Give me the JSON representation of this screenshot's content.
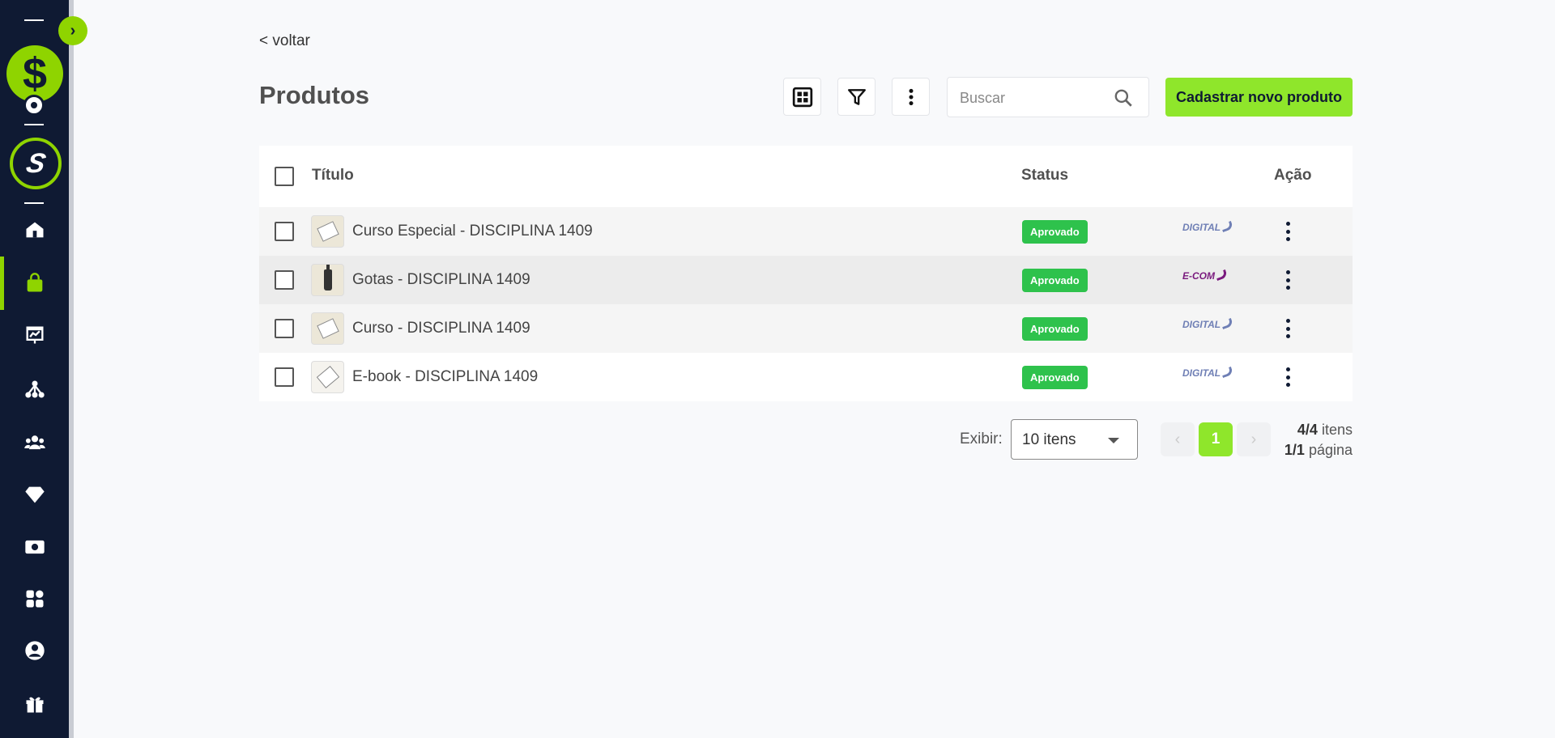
{
  "nav": {
    "back_label": "< voltar"
  },
  "page": {
    "title": "Produtos"
  },
  "search": {
    "placeholder": "Buscar"
  },
  "actions": {
    "new_product_label": "Cadastrar novo produto"
  },
  "sidebar": {
    "logo_symbol": "$",
    "brand_symbol": "S",
    "toggle_symbol": "›",
    "items": [
      {
        "name": "home",
        "icon": "home-icon",
        "active": false
      },
      {
        "name": "products",
        "icon": "shopping-bag-icon",
        "active": true
      },
      {
        "name": "reports",
        "icon": "presentation-chart-icon",
        "active": false
      },
      {
        "name": "affiliates",
        "icon": "network-icon",
        "active": false
      },
      {
        "name": "customers",
        "icon": "users-icon",
        "active": false
      },
      {
        "name": "premium",
        "icon": "diamond-icon",
        "active": false
      },
      {
        "name": "finance",
        "icon": "money-icon",
        "active": false
      },
      {
        "name": "apps",
        "icon": "apps-grid-icon",
        "active": false
      },
      {
        "name": "profile",
        "icon": "user-circle-icon",
        "active": false
      },
      {
        "name": "rewards",
        "icon": "gift-icon",
        "active": false
      }
    ]
  },
  "table": {
    "columns": {
      "title": "Título",
      "status": "Status",
      "action": "Ação"
    },
    "rows": [
      {
        "title": "Curso Especial - DISCIPLINA 1409",
        "status": "Aprovado",
        "type": "DIGITAL",
        "thumb": "paper"
      },
      {
        "title": "Gotas - DISCIPLINA 1409",
        "status": "Aprovado",
        "type": "E-COM",
        "thumb": "bottle"
      },
      {
        "title": "Curso - DISCIPLINA 1409",
        "status": "Aprovado",
        "type": "DIGITAL",
        "thumb": "paper"
      },
      {
        "title": "E-book - DISCIPLINA 1409",
        "status": "Aprovado",
        "type": "DIGITAL",
        "thumb": "doc"
      }
    ]
  },
  "pagination": {
    "show_label": "Exibir:",
    "page_size": "10 itens",
    "current_page": "1",
    "items_count": "4/4",
    "items_word": "itens",
    "pages_count": "1/1",
    "pages_word": "página"
  },
  "colors": {
    "accent": "#8fe62b",
    "sidebar": "#0f1a33",
    "status_ok": "#2ec24c"
  }
}
